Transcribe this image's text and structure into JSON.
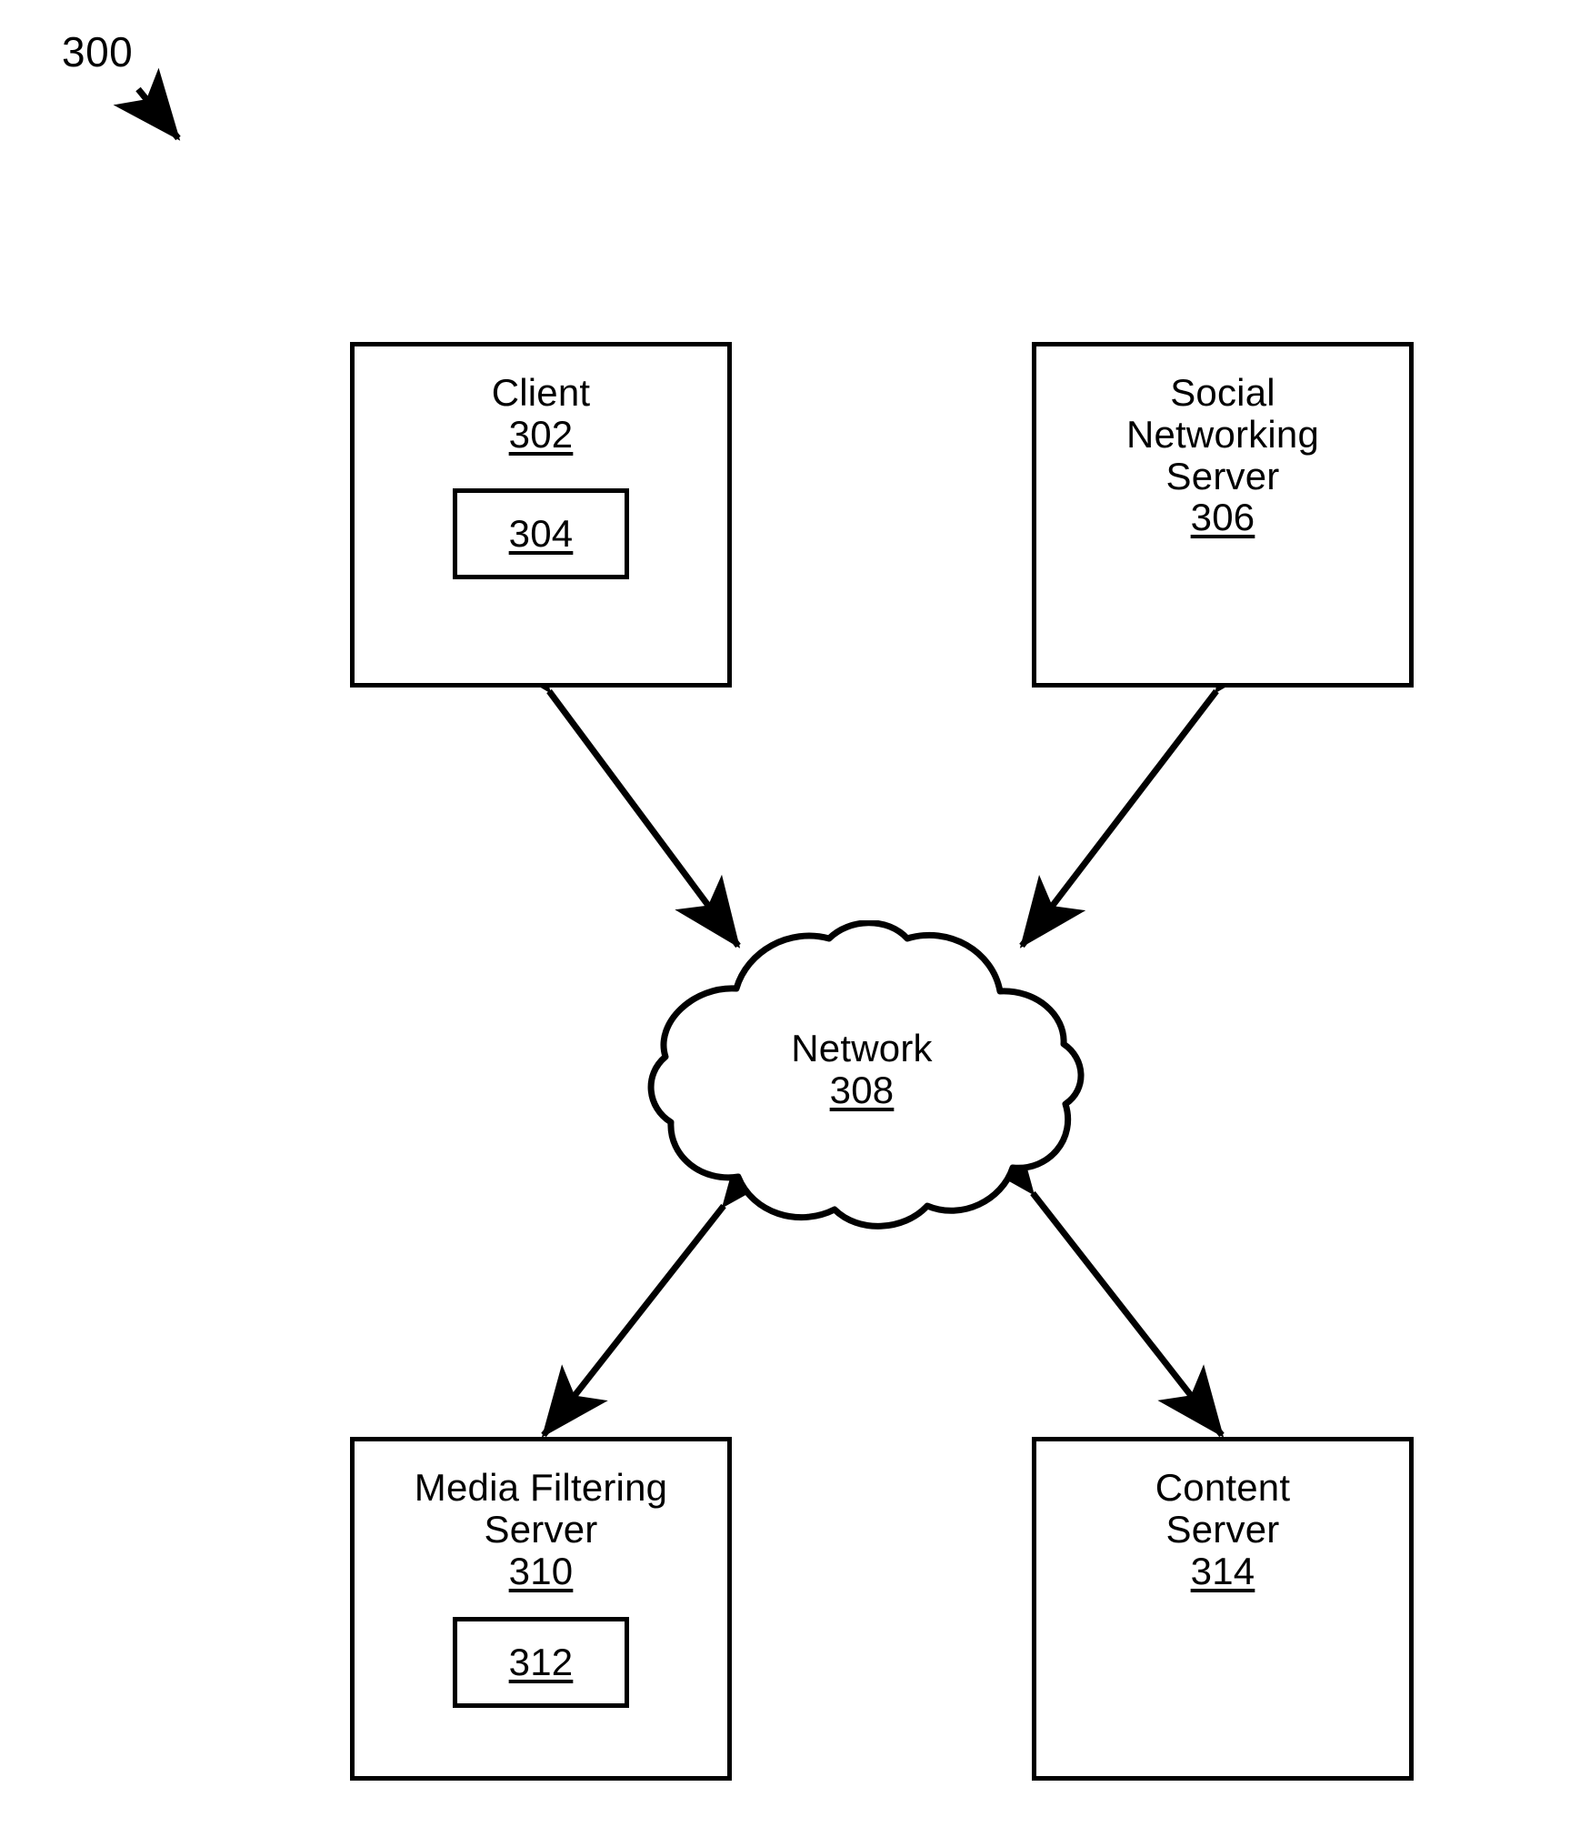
{
  "figure": {
    "reference_numeral": "300",
    "title_arrow": "down-right-arrow"
  },
  "nodes": {
    "client": {
      "label": "Client",
      "number": "302",
      "inner": {
        "number": "304"
      }
    },
    "social_networking_server": {
      "label": "Social\nNetworking\nServer",
      "number": "306"
    },
    "network": {
      "label": "Network",
      "number": "308"
    },
    "media_filtering_server": {
      "label": "Media Filtering\nServer",
      "number": "310",
      "inner": {
        "number": "312"
      }
    },
    "content_server": {
      "label": "Content\nServer",
      "number": "314"
    }
  },
  "connections": [
    {
      "name": "client-network-link",
      "from": "client",
      "to": "network",
      "style": "double-headed-arrow"
    },
    {
      "name": "social-network-link",
      "from": "social_networking_server",
      "to": "network",
      "style": "double-headed-arrow"
    },
    {
      "name": "network-media-link",
      "from": "network",
      "to": "media_filtering_server",
      "style": "double-headed-arrow"
    },
    {
      "name": "network-content-link",
      "from": "network",
      "to": "content_server",
      "style": "double-headed-arrow"
    }
  ],
  "colors": {
    "stroke": "#000000",
    "background": "#ffffff",
    "text": "#000000"
  }
}
